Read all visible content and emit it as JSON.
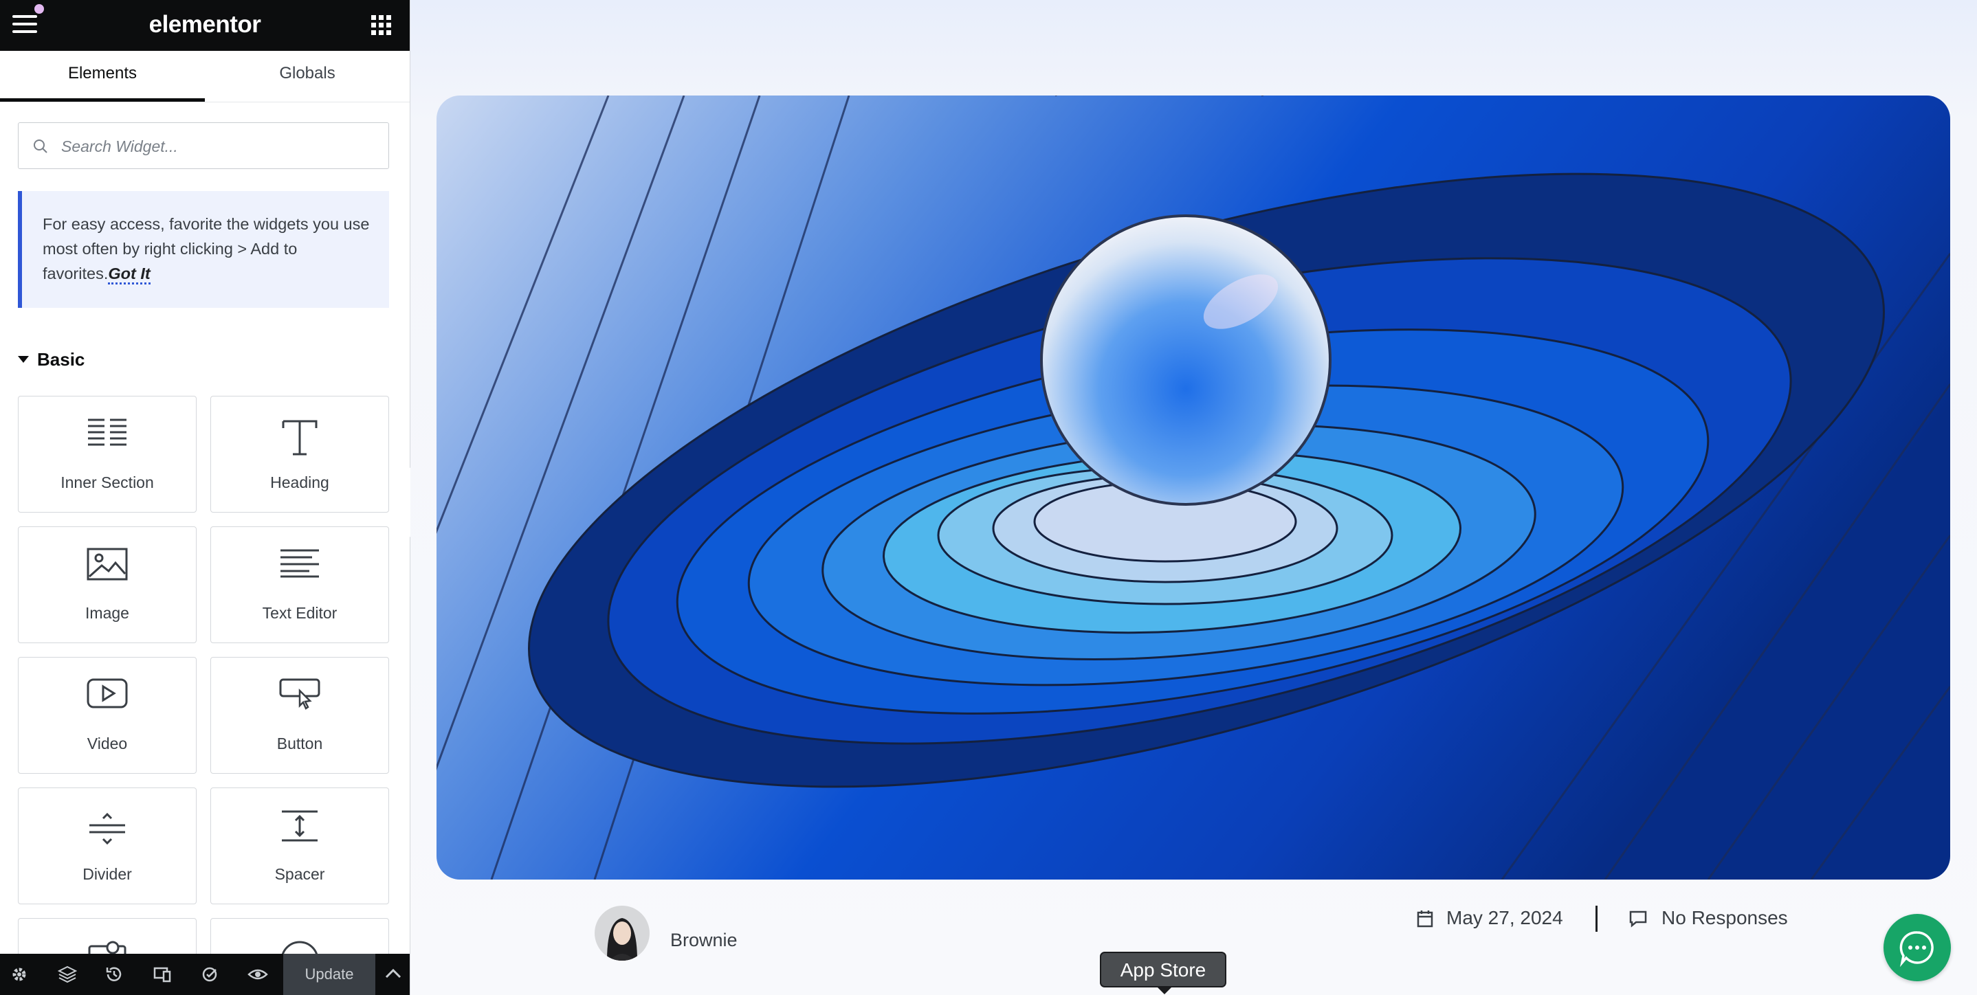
{
  "editor": {
    "brand": "elementor",
    "tabs": [
      {
        "label": "Elements",
        "active": true
      },
      {
        "label": "Globals",
        "active": false
      }
    ],
    "search": {
      "placeholder": "Search Widget...",
      "value": ""
    },
    "tip": {
      "text": "For easy access, favorite the widgets you use most often by right clicking > Add to favorites.",
      "link": "Got It"
    },
    "category": {
      "title": "Basic",
      "expanded": true
    },
    "widgets": [
      {
        "label": "Inner Section",
        "icon": "inner-section-icon"
      },
      {
        "label": "Heading",
        "icon": "heading-icon"
      },
      {
        "label": "Image",
        "icon": "image-icon"
      },
      {
        "label": "Text Editor",
        "icon": "text-editor-icon"
      },
      {
        "label": "Video",
        "icon": "video-icon"
      },
      {
        "label": "Button",
        "icon": "button-icon"
      },
      {
        "label": "Divider",
        "icon": "divider-icon"
      },
      {
        "label": "Spacer",
        "icon": "spacer-icon"
      }
    ],
    "footer": {
      "icons": [
        "settings-icon",
        "navigator-icon",
        "history-icon",
        "responsive-mode-icon",
        "site-settings-icon",
        "preview-icon"
      ],
      "update_label": "Update"
    }
  },
  "post": {
    "author": "Brownie",
    "date": "May 27, 2024",
    "responses": "No Responses"
  },
  "tooltip": "App Store",
  "colors": {
    "accent": "#2f57d6",
    "chat": "#17a567",
    "dark": "#0c0d0e"
  }
}
